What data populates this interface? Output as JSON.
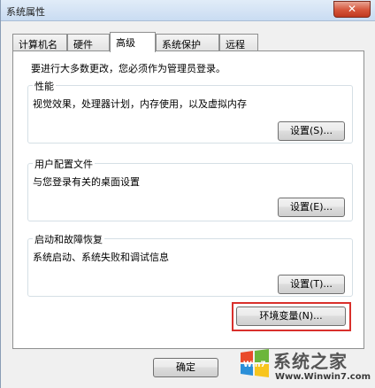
{
  "window": {
    "title": "系统属性",
    "close_glyph": "✕"
  },
  "tabs": [
    {
      "label": "计算机名",
      "active": false
    },
    {
      "label": "硬件",
      "active": false
    },
    {
      "label": "高级",
      "active": true
    },
    {
      "label": "系统保护",
      "active": false
    },
    {
      "label": "远程",
      "active": false
    }
  ],
  "notice": "要进行大多数更改，您必须作为管理员登录。",
  "groups": {
    "performance": {
      "label": "性能",
      "description": "视觉效果，处理器计划，内存使用，以及虚拟内存",
      "button": "设置(S)..."
    },
    "user_profiles": {
      "label": "用户配置文件",
      "description": "与您登录有关的桌面设置",
      "button": "设置(E)..."
    },
    "startup_recovery": {
      "label": "启动和故障恢复",
      "description": "系统启动、系统失败和调试信息",
      "button": "设置(T)..."
    }
  },
  "env_button": "环境变量(N)...",
  "ok_button": "确定",
  "watermark": {
    "brand": "系统之家",
    "url": "Www.Winwin7.com",
    "logo_text": "Win7"
  },
  "colors": {
    "highlight": "#d9302c",
    "close": "#c0391f"
  }
}
